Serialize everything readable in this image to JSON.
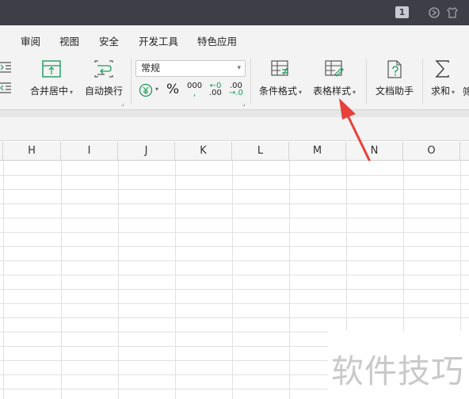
{
  "titlebar": {
    "badge": "1",
    "icons": [
      "sync-icon",
      "shirt-icon"
    ],
    "bg_color": "#3e3e46"
  },
  "menu": {
    "items": [
      "审阅",
      "视图",
      "安全",
      "开发工具",
      "特色应用"
    ]
  },
  "ribbon": {
    "merge_center": "合并居中",
    "wrap_text": "自动换行",
    "number_format": "常规",
    "percent": "%",
    "thousands": "000",
    "dec_increase_top": "←0",
    "dec_increase_bottom": ".00",
    "dec_decrease_top": ".00",
    "dec_decrease_bottom": "→.0",
    "conditional_format": "条件格式",
    "table_style": "表格样式",
    "doc_helper": "文档助手",
    "sum": "求和",
    "icon_color": "#1a9b5a"
  },
  "grid": {
    "columns": [
      "H",
      "I",
      "J",
      "K",
      "L",
      "M",
      "N",
      "O"
    ]
  },
  "watermark": "软件技巧",
  "annotation": {
    "arrow_color": "#e8403a"
  }
}
